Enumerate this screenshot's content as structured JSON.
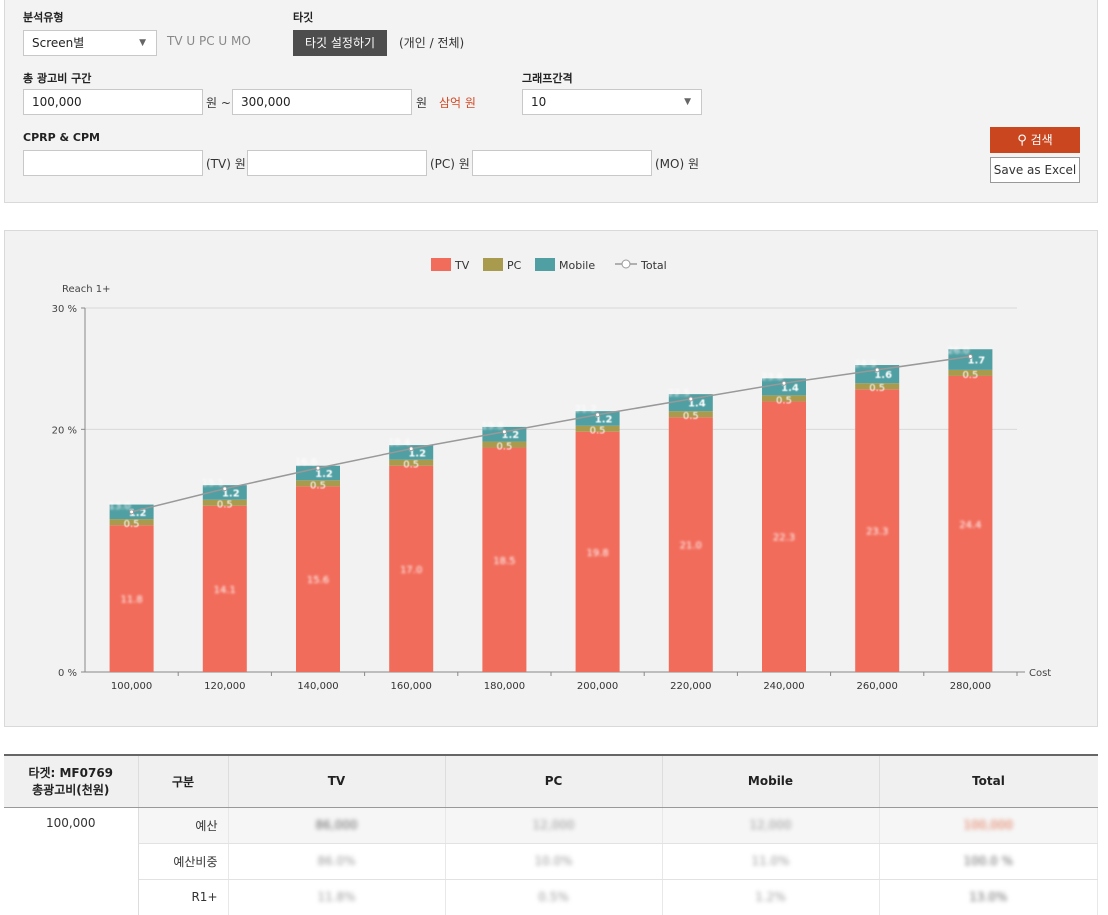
{
  "filter": {
    "analysis_type": {
      "label": "분석유형",
      "value": "Screen별",
      "media_text": "TV U PC U MO"
    },
    "target": {
      "label": "타깃",
      "button": "타깃 설정하기",
      "note": "(개인 / 전체)"
    },
    "cost_range": {
      "label": "총 광고비 구간",
      "from": "100,000",
      "won_tilde": "원 ~",
      "to": "300,000",
      "won": "원",
      "unit_hint": "삼억 원"
    },
    "graph_interval": {
      "label": "그래프간격",
      "value": "10"
    },
    "cprp": {
      "label": "CPRP & CPM",
      "tv_unit": "(TV) 원",
      "pc_unit": "(PC) 원",
      "mo_unit": "(MO) 원"
    },
    "search_button": "검색",
    "excel_button": "Save as Excel"
  },
  "chart_data": {
    "type": "bar",
    "stacked": true,
    "categories": [
      "100,000",
      "120,000",
      "140,000",
      "160,000",
      "180,000",
      "200,000",
      "220,000",
      "240,000",
      "260,000",
      "280,000"
    ],
    "series": [
      {
        "name": "TV",
        "color": "#f26c5b",
        "values": [
          12.1,
          13.7,
          15.3,
          17.0,
          18.5,
          19.8,
          21.0,
          22.3,
          23.3,
          24.4
        ]
      },
      {
        "name": "PC",
        "color": "#a89b4e",
        "values": [
          0.5,
          0.5,
          0.5,
          0.5,
          0.5,
          0.5,
          0.5,
          0.5,
          0.5,
          0.5
        ]
      },
      {
        "name": "Mobile",
        "color": "#4f9fa3",
        "values": [
          1.2,
          1.2,
          1.2,
          1.2,
          1.2,
          1.2,
          1.4,
          1.4,
          1.5,
          1.7
        ]
      }
    ],
    "line": {
      "name": "Total",
      "color": "#999999",
      "values": [
        13.2,
        15.1,
        16.8,
        18.4,
        19.8,
        21.2,
        22.5,
        23.8,
        24.9,
        26.0
      ]
    },
    "tv_labels": [
      "11.8",
      "14.1",
      "15.6",
      "17.0",
      "18.5",
      "19.8",
      "21.0",
      "22.3",
      "23.3",
      "24.4"
    ],
    "pc_labels": [
      "0.5",
      "0.5",
      "0.5",
      "0.5",
      "0.5",
      "0.5",
      "0.5",
      "0.5",
      "0.5",
      "0.5"
    ],
    "mobile_labels": [
      "1.2",
      "1.2",
      "1.2",
      "1.2",
      "1.2",
      "1.2",
      "1.4",
      "1.4",
      "1.6",
      "1.7"
    ],
    "total_labels": [
      "13.0",
      "15.1",
      "16.8",
      "18.4",
      "19.8",
      "21.2",
      "22.5",
      "23.8",
      "24.9",
      "26.0"
    ],
    "ylabel": "Reach 1+",
    "xlabel": "Cost",
    "ylim": [
      0,
      30
    ],
    "yticks": [
      0,
      20,
      30
    ],
    "ytick_suffix": " %",
    "legend_position": "top-center",
    "grid": true
  },
  "table": {
    "target_header": "타겟: MF0769",
    "cost_header": "총광고비(천원)",
    "col_headers": [
      "구분",
      "TV",
      "PC",
      "Mobile",
      "Total"
    ],
    "cost_value": "100,000",
    "rows": [
      {
        "label": "예산",
        "values": [
          "86,000",
          "12,000",
          "12,000",
          "100,000"
        ]
      },
      {
        "label": "예산비중",
        "values": [
          "86.0%",
          "10.0%",
          "11.0%",
          "100.0 %"
        ]
      },
      {
        "label": "R1+",
        "values": [
          "11.8%",
          "0.5%",
          "1.2%",
          "13.0%"
        ]
      }
    ]
  },
  "colors": {
    "accent": "#c9461f",
    "dark_button": "#4d4d4d",
    "panel_bg": "#f3f3f3"
  }
}
